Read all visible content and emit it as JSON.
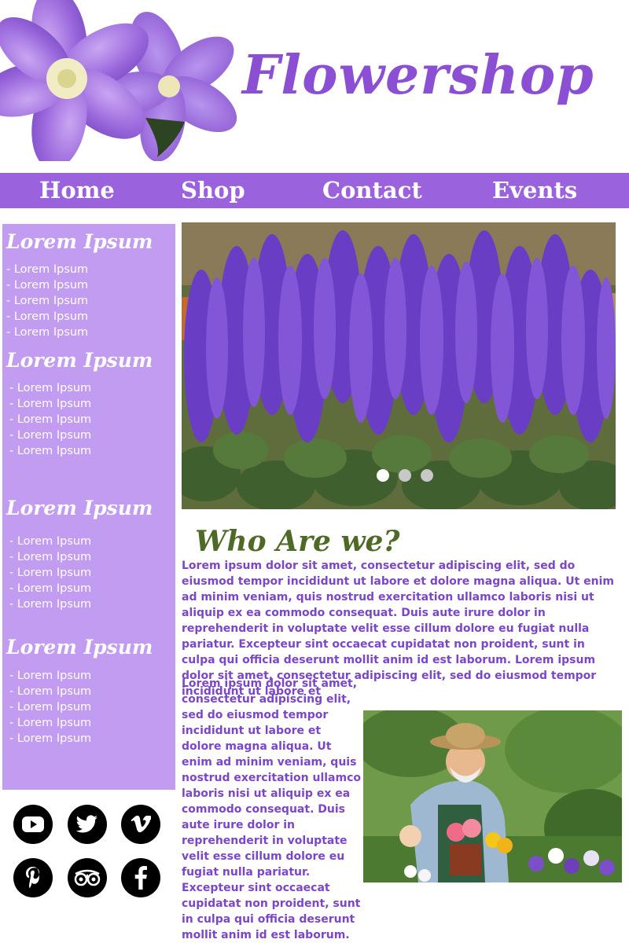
{
  "header": {
    "title": "Flowershop"
  },
  "nav": {
    "items": [
      "Home",
      "Shop",
      "Contact",
      "Events"
    ]
  },
  "sidebar": {
    "sections": [
      {
        "heading": "Lorem Ipsum",
        "items": [
          "- Lorem Ipsum",
          "- Lorem Ipsum",
          "- Lorem Ipsum",
          "- Lorem Ipsum",
          "- Lorem Ipsum"
        ]
      },
      {
        "heading": "Lorem Ipsum",
        "items": [
          "- Lorem Ipsum",
          "- Lorem Ipsum",
          "- Lorem Ipsum",
          "- Lorem Ipsum",
          "- Lorem Ipsum"
        ]
      },
      {
        "heading": "Lorem Ipsum",
        "items": [
          "- Lorem Ipsum",
          "- Lorem Ipsum",
          "- Lorem Ipsum",
          "- Lorem Ipsum",
          "- Lorem Ipsum"
        ]
      },
      {
        "heading": "Lorem Ipsum",
        "items": [
          "- Lorem Ipsum",
          "- Lorem Ipsum",
          "- Lorem Ipsum",
          "- Lorem Ipsum",
          "- Lorem Ipsum"
        ]
      }
    ]
  },
  "social": {
    "icons": [
      "youtube-icon",
      "twitter-icon",
      "vimeo-icon",
      "pinterest-icon",
      "tripadvisor-icon",
      "facebook-icon"
    ]
  },
  "slider": {
    "active_slide": 1,
    "slide_count": 3
  },
  "content": {
    "heading": "Who Are we?",
    "paragraph1": "Lorem ipsum dolor sit amet, consectetur adipiscing elit, sed do eiusmod tempor incididunt ut labore et dolore magna aliqua. Ut enim ad minim veniam, quis nostrud exercitation ullamco laboris nisi ut aliquip ex ea commodo consequat. Duis aute irure dolor in reprehenderit in voluptate velit esse cillum dolore eu fugiat nulla pariatur. Excepteur sint occaecat cupidatat non proident, sunt in culpa qui officia deserunt mollit anim id est laborum. Lorem ipsum dolor sit amet, consectetur adipiscing elit, sed do eiusmod tempor incididunt ut labore et",
    "paragraph2": "Lorem ipsum dolor sit amet, consectetur adipiscing elit, sed do eiusmod tempor incididunt ut labore et dolore magna aliqua. Ut enim ad minim veniam, quis nostrud exercitation ullamco laboris nisi ut aliquip ex ea commodo consequat. Duis aute irure dolor in reprehenderit in voluptate velit esse cillum dolore eu fugiat nulla pariatur. Excepteur sint occaecat cupidatat non proident, sunt in culpa qui officia deserunt mollit anim id est laborum."
  },
  "colors": {
    "brand_purple": "#8a4fd3",
    "nav_bg": "#9a62dd",
    "sidebar_bg": "#c29cf0",
    "heading_green": "#4f6a26",
    "dot_active": "#ffffff",
    "dot_inactive": "#c8c8c8"
  }
}
